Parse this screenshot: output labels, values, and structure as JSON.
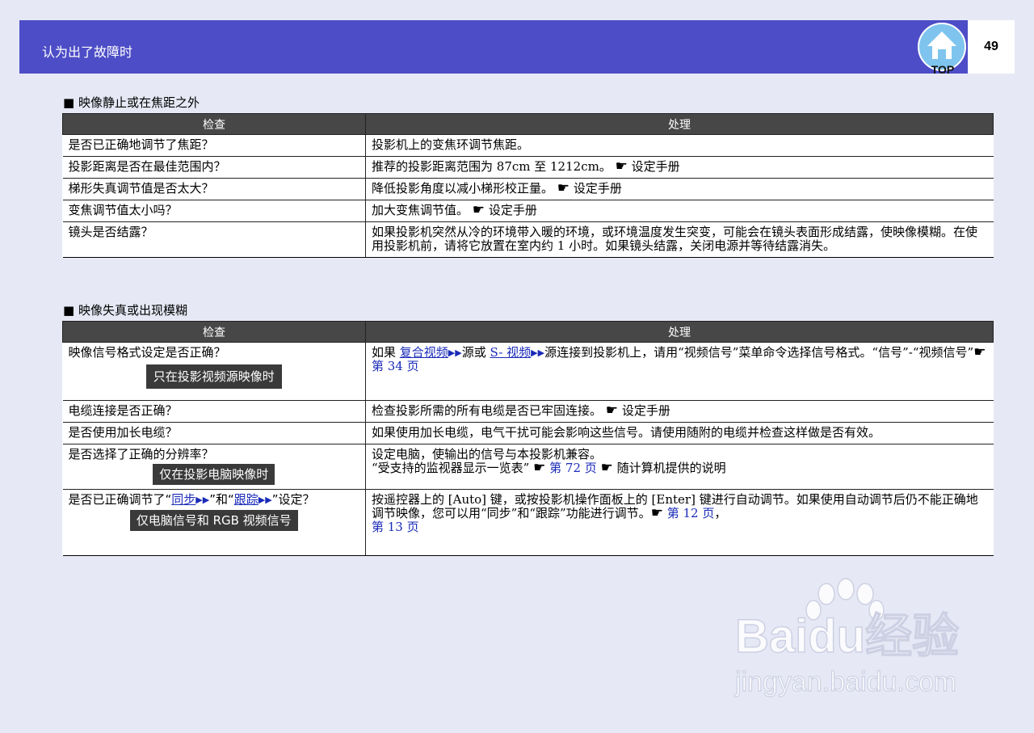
{
  "header": {
    "title": "认为出了故障时",
    "page_number": "49",
    "top_label": "TOP"
  },
  "section1": {
    "title": "■ 映像静止或在焦距之外",
    "col_check": "检查",
    "col_action": "处理",
    "rows": [
      {
        "q": "是否已正确地调节了焦距？",
        "a": "投影机上的变焦环调节焦距。"
      },
      {
        "q": "投影距离是否在最佳范围内？",
        "a": "推荐的投影距离范围为 87cm 至 1212cm。",
        "ref": "设定手册"
      },
      {
        "q": "梯形失真调节值是否太大？",
        "a": "降低投影角度以减小梯形校正量。",
        "ref": "设定手册"
      },
      {
        "q": "变焦调节值太小吗？",
        "a": "加大变焦调节值。",
        "ref": "设定手册"
      },
      {
        "q": "镜头是否结露？",
        "a": "如果投影机突然从冷的环境带入暖的环境，或环境温度发生突变，可能会在镜头表面形成结露，使映像模糊。在使用投影机前，请将它放置在室内约 1 小时。如果镜头结露，关闭电源并等待结露消失。"
      }
    ]
  },
  "section2": {
    "title": "■ 映像失真或出现模糊",
    "col_check": "检查",
    "col_action": "处理",
    "row1": {
      "q": "映像信号格式设定是否正确？",
      "badge": "只在投影视频源映像时",
      "a_prefix": "如果 ",
      "link1": "复合视频",
      "a_mid1": "源或 ",
      "link2": "S- 视频",
      "a_mid2": "源连接到投影机上，请用“视频信号”菜单命令选择信号格式。“信号”-“视频信号”",
      "ref": "第 34 页"
    },
    "row2": {
      "q": "电缆连接是否正确？",
      "a": "检查投影所需的所有电缆是否已牢固连接。",
      "ref": "设定手册"
    },
    "row3": {
      "q": "是否使用加长电缆？",
      "a": "如果使用加长电缆，电气干扰可能会影响这些信号。请使用随附的电缆并检查这样做是否有效。"
    },
    "row4": {
      "q": "是否选择了正确的分辨率？",
      "badge": "仅在投影电脑映像时",
      "a1": "设定电脑，使输出的信号与本投影机兼容。",
      "a2": "“受支持的监视器显示一览表”",
      "ref1": "第 72 页",
      "ref2": "随计算机提供的说明"
    },
    "row5": {
      "q_prefix": "是否已正确调节了“",
      "link1": "同步",
      "q_mid": "”和“",
      "link2": "跟踪",
      "q_suffix": "”设定？",
      "badge": "仅电脑信号和 RGB 视频信号",
      "a": "按遥控器上的 [Auto] 键，或按投影机操作面板上的 [Enter] 键进行自动调节。如果使用自动调节后仍不能正确地调节映像，您可以用“同步”和“跟踪”功能进行调节。",
      "ref1": "第 12 页",
      "sep": "，",
      "ref2": "第 13 页"
    }
  },
  "watermark": {
    "brand": "Baidu经验",
    "url": "jingyan.baidu.com"
  }
}
